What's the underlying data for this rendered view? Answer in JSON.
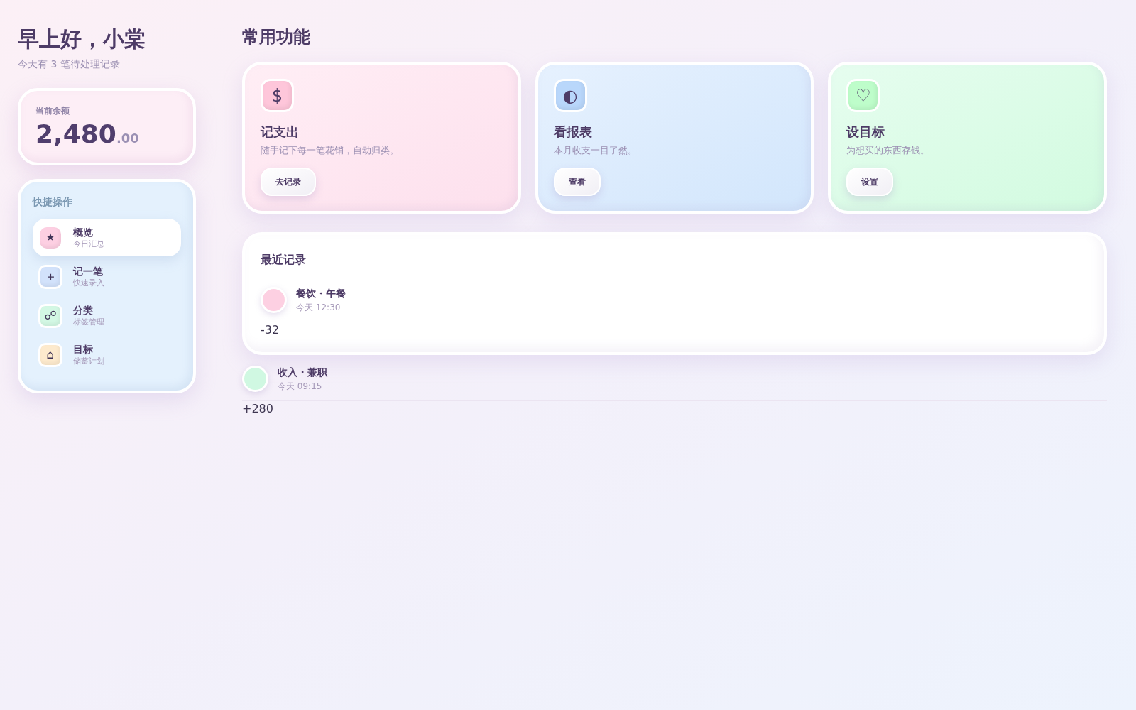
{
  "greeting": {
    "title": "早上好，小棠",
    "subtitle": "今天有 3 笔待处理记录"
  },
  "balance": {
    "label": "当前余额",
    "integer": "2,480",
    "decimal": ".00"
  },
  "quick_actions": {
    "title": "快捷操作",
    "items": [
      {
        "icon": "★",
        "label": "概览",
        "sublabel": "今日汇总",
        "color": "#fdcfe2",
        "selected": true
      },
      {
        "icon": "＋",
        "label": "记一笔",
        "sublabel": "快速录入",
        "color": "#d2e2fb",
        "selected": false
      },
      {
        "icon": "☍",
        "label": "分类",
        "sublabel": "标签管理",
        "color": "#d3f8e4",
        "selected": false
      },
      {
        "icon": "⌂",
        "label": "目标",
        "sublabel": "储蓄计划",
        "color": "#fdeacd",
        "selected": false
      }
    ]
  },
  "features": {
    "title": "常用功能",
    "cards": [
      {
        "icon": "$",
        "title": "记支出",
        "description": "随手记下每一笔花销，自动归类。",
        "button": "去记录",
        "color": "#fec6da"
      },
      {
        "icon": "◐",
        "title": "看报表",
        "description": "本月收支一目了然。",
        "button": "查看",
        "color": "#b9d7fb"
      },
      {
        "icon": "♡",
        "title": "设目标",
        "description": "为想买的东西存钱。",
        "button": "设置",
        "color": "#befdca"
      }
    ]
  },
  "recent": {
    "title": "最近记录",
    "records": [
      {
        "name": "餐饮・午餐",
        "time": "今天 12:30",
        "amount": "-32",
        "color": "#fdd0e2"
      },
      {
        "name": "收入・兼职",
        "time": "今天 09:15",
        "amount": "+280",
        "color": "#d0f8e2"
      }
    ]
  }
}
